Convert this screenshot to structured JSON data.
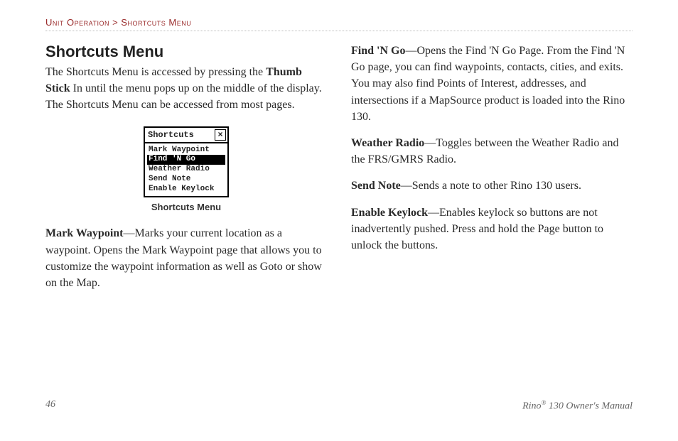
{
  "breadcrumb": {
    "section": "Unit Operation",
    "separator": " > ",
    "page": "Shortcuts Menu"
  },
  "heading": "Shortcuts Menu",
  "intro": {
    "part1": "The Shortcuts Menu is accessed by pressing the ",
    "bold1": "Thumb Stick",
    "part2": " In until the menu pops up on the middle of the display. The Shortcuts Menu can be accessed from most pages."
  },
  "figure": {
    "title": "Shortcuts",
    "items": [
      {
        "label": "Mark Waypoint",
        "selected": false
      },
      {
        "label": "Find 'N Go",
        "selected": true
      },
      {
        "label": "Weather Radio",
        "selected": false
      },
      {
        "label": "Send Note",
        "selected": false
      },
      {
        "label": "Enable Keylock",
        "selected": false
      }
    ],
    "caption": "Shortcuts Menu"
  },
  "entries": [
    {
      "term": "Mark Waypoint",
      "desc": "—Marks your current location as a waypoint. Opens the Mark Waypoint page that allows you to customize the waypoint information as well as Goto or show on the Map."
    },
    {
      "term": "Find 'N Go",
      "desc": "—Opens the Find 'N Go Page. From the Find 'N Go page, you can find waypoints, contacts, cities, and exits. You may also find Points of Interest, addresses, and intersections if a MapSource product is loaded into the Rino 130."
    },
    {
      "term": "Weather Radio",
      "desc": "—Toggles between the Weather Radio and the FRS/GMRS Radio."
    },
    {
      "term": "Send Note",
      "desc": "—Sends a note to other Rino 130 users."
    },
    {
      "term": "Enable Keylock",
      "desc": "—Enables keylock so buttons are not inadvertently pushed. Press and hold the Page button to unlock the buttons."
    }
  ],
  "footer": {
    "pageNumber": "46",
    "manualPrefix": "Rino",
    "manualSuffix": " 130 Owner's Manual",
    "reg": "®"
  }
}
